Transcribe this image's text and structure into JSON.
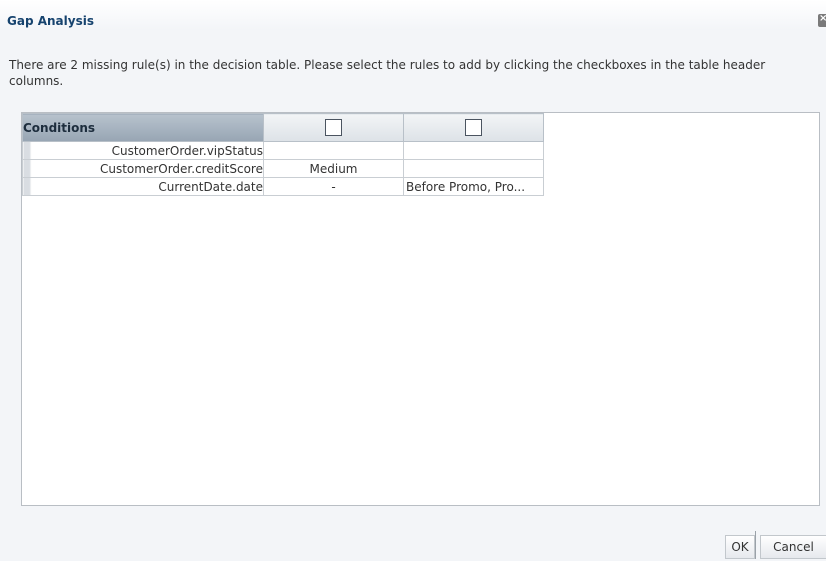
{
  "dialog": {
    "title": "Gap Analysis",
    "message": "There are 2 missing rule(s) in the decision table. Please select the rules to add by clicking the checkboxes in the table header columns."
  },
  "table": {
    "header_label": "Conditions",
    "rules": [
      {
        "checked": false
      },
      {
        "checked": false
      }
    ],
    "rows": [
      {
        "label": "CustomerOrder.vipStatus",
        "values": [
          "",
          ""
        ]
      },
      {
        "label": "CustomerOrder.creditScore",
        "values": [
          "Medium",
          ""
        ]
      },
      {
        "label": "CurrentDate.date",
        "values": [
          "-",
          "Before Promo, Pro..."
        ]
      }
    ]
  },
  "buttons": {
    "ok_label": "OK",
    "cancel_label": "Cancel"
  },
  "icons": {
    "close": "close-icon"
  }
}
